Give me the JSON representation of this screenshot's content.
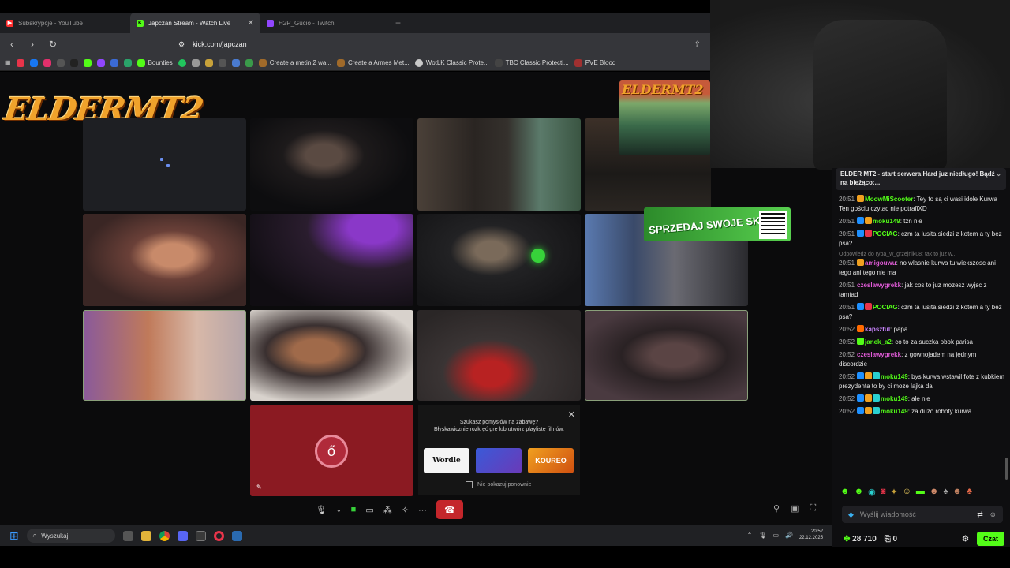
{
  "browser": {
    "tabs": [
      {
        "label": "Subskrypcje - YouTube",
        "color": "#ff2d2d",
        "glyph": "▶"
      },
      {
        "label": "Japczan Stream - Watch Live",
        "color": "#53fc18",
        "glyph": "K"
      },
      {
        "label": "H2P_Gucio - Twitch",
        "color": "#9146ff",
        "glyph": ""
      }
    ],
    "url": "kick.com/japczan",
    "bookmarks": [
      "Bounties",
      "Create a metin 2 wa...",
      "Create a Armes Met...",
      "WotLK Classic Prote...",
      "TBC Classic Protecti...",
      "PVE Blood"
    ]
  },
  "stream": {
    "logo_text": "ELDERMT2",
    "logo_small": "ELDERMT2",
    "promo_text": "SPRZEDAJ SWOJE SKINY!",
    "popup": {
      "title_line1": "Szukasz pomysłów na zabawę?",
      "title_line2": "Błyskawicznie rozkręć grę lub utwórz playlistę filmów.",
      "games": [
        "Wordle",
        "",
        "KOUREO"
      ],
      "checkbox_label": "Nie pokazuj ponownie"
    }
  },
  "taskbar": {
    "search_placeholder": "Wyszukaj",
    "time": "20:52",
    "date": "22.12.2025"
  },
  "chat": {
    "pinned": "ELDER MT2 - start serwera Hard juz niedługo! Bądź na bieżąco:...",
    "messages": [
      {
        "time": "20:51",
        "user": "MoowMiScooter",
        "color": "#53fc18",
        "text": ": Tey to są ci wasi idole Kurwa Ten gościu czytac nie potrafiXD"
      },
      {
        "time": "20:51",
        "user": "moku149",
        "color": "#53fc18",
        "text": ": tzn nie"
      },
      {
        "time": "20:51",
        "user": "POCIAG",
        "color": "#53fc18",
        "text": ": czm ta lusita siedzi z kotem a ty bez psa?"
      },
      {
        "time": "20:51",
        "user": "amigouwu",
        "color": "#e05bd7",
        "text": ": no wlasnie kurwa tu wiekszosc ani tego ani tego nie ma"
      },
      {
        "time": "20:51",
        "user": "czeslawygrekk",
        "color": "#e05bd7",
        "text": ": jak cos to juz mozesz wyjsc z tamtad"
      },
      {
        "time": "20:51",
        "user": "POCIAG",
        "color": "#53fc18",
        "text": ": czm ta lusita siedzi z kotem a ty bez psa?"
      },
      {
        "time": "20:52",
        "user": "kapsztul",
        "color": "#c985ff",
        "text": ": papa"
      },
      {
        "time": "20:52",
        "user": "janek_a2",
        "color": "#53fc18",
        "text": ": co to za suczka obok parisa"
      },
      {
        "time": "20:52",
        "user": "czeslawygrekk",
        "color": "#e05bd7",
        "text": ": z gownojadem na jednym discordzie"
      },
      {
        "time": "20:52",
        "user": "moku149",
        "color": "#53fc18",
        "text": ": bys kurwa wstawil fote z kubkiem prezydenta to by ci moze lajka dal"
      },
      {
        "time": "20:52",
        "user": "moku149",
        "color": "#53fc18",
        "text": ": ale nie"
      },
      {
        "time": "20:52",
        "user": "moku149",
        "color": "#53fc18",
        "text": ": za duzo roboty kurwa"
      }
    ],
    "reply_hint": "Odpowiedz do ryba_w_grzejniku8: tak to juz w...",
    "input_placeholder": "Wyślij wiadomość",
    "kick_coins": "28 710",
    "gifts": "0",
    "send_label": "Czat"
  }
}
